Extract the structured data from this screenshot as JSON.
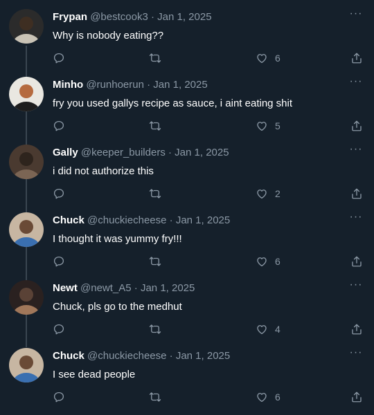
{
  "tweets": [
    {
      "name": "Frypan",
      "handle": "@bestcook3",
      "separator": "·",
      "date": "Jan 1, 2025",
      "text": "Why is nobody eating??",
      "likes": "6",
      "avatar_colors": [
        "#2b2b2b",
        "#c9c3b6",
        "#3e2e22"
      ]
    },
    {
      "name": "Minho",
      "handle": "@runhoerun",
      "separator": "·",
      "date": "Jan 1, 2025",
      "text": "fry you used gallys recipe as sauce, i aint eating shit",
      "likes": "5",
      "avatar_colors": [
        "#e9e7e1",
        "#1d1d1d",
        "#b56a3f"
      ]
    },
    {
      "name": "Gally",
      "handle": "@keeper_builders",
      "separator": "·",
      "date": "Jan 1, 2025",
      "text": "i did not authorize this",
      "likes": "2",
      "avatar_colors": [
        "#4a3a30",
        "#7b6554",
        "#2e241d"
      ]
    },
    {
      "name": "Chuck",
      "handle": "@chuckiecheese",
      "separator": "·",
      "date": "Jan 1, 2025",
      "text": "I thought it was yummy fry!!!",
      "likes": "6",
      "avatar_colors": [
        "#c7b6a2",
        "#3a6fb0",
        "#6a4a36"
      ]
    },
    {
      "name": "Newt",
      "handle": "@newt_A5",
      "separator": "·",
      "date": "Jan 1, 2025",
      "text": "Chuck, pls go to the medhut",
      "likes": "4",
      "avatar_colors": [
        "#2a2120",
        "#a0775a",
        "#5a4236"
      ]
    },
    {
      "name": "Chuck",
      "handle": "@chuckiecheese",
      "separator": "·",
      "date": "Jan 1, 2025",
      "text": "I see dead people",
      "likes": "6",
      "avatar_colors": [
        "#c7b6a2",
        "#3a6fb0",
        "#6a4a36"
      ]
    }
  ],
  "more_label": "···",
  "icons": {
    "more": "more-horizontal-icon",
    "reply": "reply-icon",
    "retweet": "retweet-icon",
    "like": "heart-icon",
    "share": "share-icon"
  },
  "colors": {
    "background": "#15202b",
    "muted": "#8b98a5",
    "thread_line": "#3a4651"
  }
}
